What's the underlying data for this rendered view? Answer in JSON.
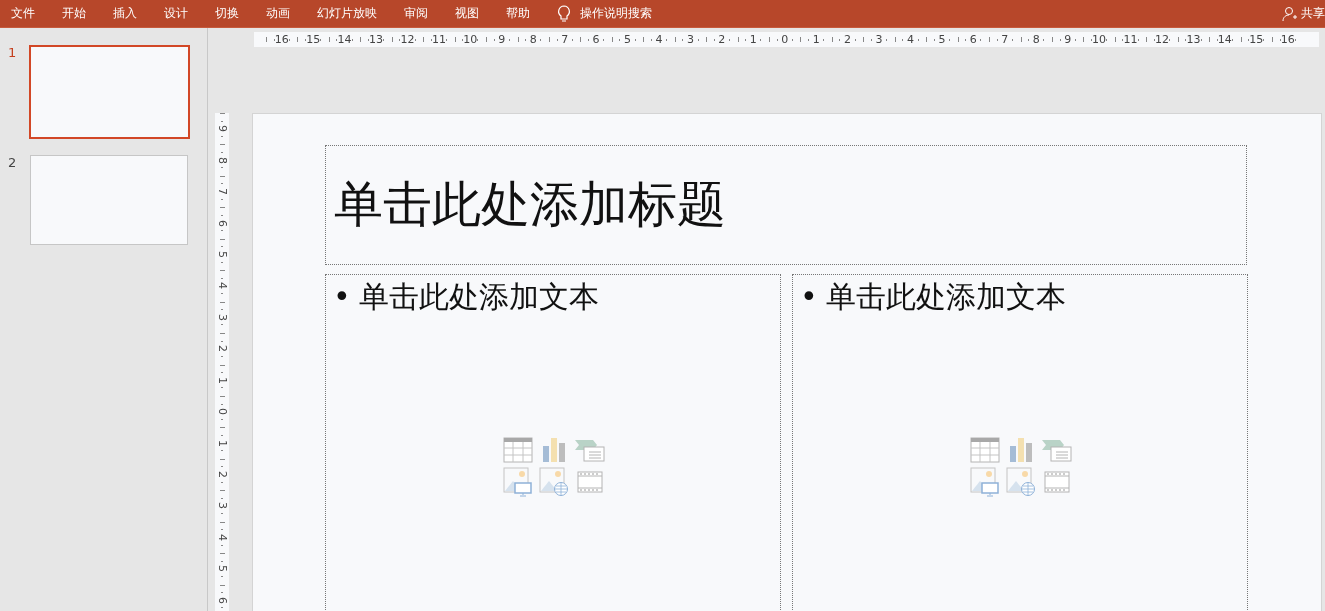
{
  "menu": {
    "tabs": [
      {
        "label": "文件"
      },
      {
        "label": "开始"
      },
      {
        "label": "插入"
      },
      {
        "label": "设计"
      },
      {
        "label": "切换"
      },
      {
        "label": "动画"
      },
      {
        "label": "幻灯片放映"
      },
      {
        "label": "审阅"
      },
      {
        "label": "视图"
      },
      {
        "label": "帮助"
      }
    ],
    "search": "操作说明搜索",
    "share": "共享"
  },
  "thumbnails": [
    {
      "number": "1",
      "selected": true
    },
    {
      "number": "2",
      "selected": false
    }
  ],
  "rulers": {
    "horizontal": [
      "16",
      "15",
      "14",
      "13",
      "12",
      "11",
      "10",
      "9",
      "8",
      "7",
      "6",
      "5",
      "4",
      "3",
      "2",
      "1",
      "0",
      "1",
      "2",
      "3",
      "4",
      "5",
      "6",
      "7",
      "8",
      "9",
      "10",
      "11",
      "12",
      "13",
      "14",
      "15",
      "16"
    ],
    "vertical": [
      "9",
      "8",
      "7",
      "6",
      "5",
      "4",
      "3",
      "2",
      "1",
      "0",
      "1",
      "2",
      "3",
      "4",
      "5",
      "6"
    ]
  },
  "slide": {
    "title_placeholder": "单击此处添加标题",
    "content_placeholders": [
      {
        "bullet": "•",
        "text": "单击此处添加文本"
      },
      {
        "bullet": "•",
        "text": "单击此处添加文本"
      }
    ]
  }
}
